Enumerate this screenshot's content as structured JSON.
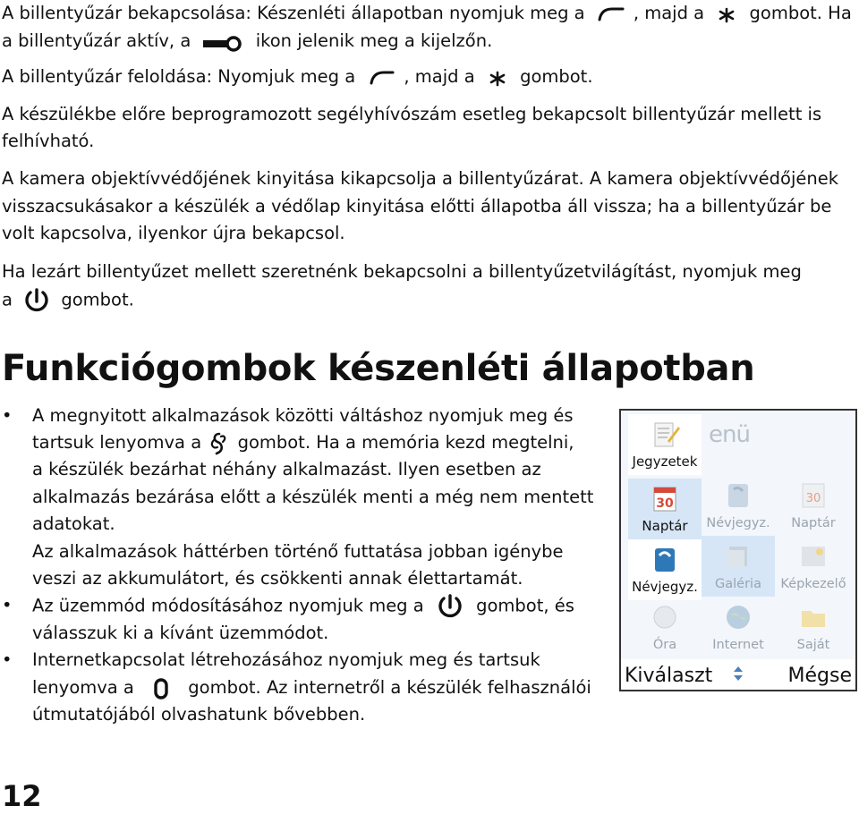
{
  "paragraphs": {
    "p1_line1_a": "A billentyűzár bekapcsolása: Készenléti állapotban nyomjuk meg a",
    "p1_line1_b": ", majd a",
    "p1_line1_c": "gombot. Ha",
    "p1_line2_a": "a billentyűzár aktív, a",
    "p1_line2_b": "ikon jelenik meg a kijelzőn.",
    "p2_a": "A billentyűzár feloldása: Nyomjuk meg a",
    "p2_b": ", majd a",
    "p2_c": "gombot.",
    "p3_line1": "A készülékbe előre beprogramozott segélyhívószám esetleg bekapcsolt billentyűzár mellett is",
    "p3_line2": "felhívható.",
    "p4_line1": "A kamera objektívvédőjének kinyitása kikapcsolja a billentyűzárat. A kamera objektívvédőjének",
    "p4_line2": "visszacsukásakor a készülék a védőlap kinyitása előtti állapotba áll vissza; ha a billentyűzár be",
    "p4_line3": "volt kapcsolva, ilyenkor újra bekapcsol.",
    "p5_line1": "Ha lezárt billentyűzet mellett szeretnénk bekapcsolni a billentyűzetvilágítást, nyomjuk meg",
    "p5_line2_a": "a",
    "p5_line2_b": "gombot."
  },
  "heading": "Funkciógombok készenléti állapotban",
  "bullets": {
    "b1_l1": "A megnyitott alkalmazások közötti váltáshoz nyomjuk meg és",
    "b1_l2_a": "tartsuk lenyomva a",
    "b1_l2_b": "gombot. Ha a memória kezd megtelni,",
    "b1_l3": "a készülék bezárhat néhány alkalmazást. Ilyen esetben az",
    "b1_l4": "alkalmazás bezárása előtt a készülék menti a még nem mentett",
    "b1_l5": "adatokat.",
    "b1_l6": "Az alkalmazások háttérben történő futtatása jobban igénybe",
    "b1_l7": "veszi az akkumulátort, és csökkenti annak élettartamát.",
    "b2_l1_a": "Az üzemmód módosításához nyomjuk meg a",
    "b2_l1_b": "gombot, és",
    "b2_l2": "válasszuk ki a kívánt üzemmódot.",
    "b3_l1": "Internetkapcsolat létrehozásához nyomjuk meg és tartsuk",
    "b3_l2_a": "lenyomva a",
    "b3_l2_b": "gombot. Az internetről a készülék felhasználói",
    "b3_l3": "útmutatójából olvashatunk bővebben."
  },
  "bullet_glyph": "•",
  "phone": {
    "title_fragment": "enü",
    "front_items": [
      "Jegyzetek",
      "Naptár",
      "Névjegyz."
    ],
    "back_items": [
      "Névjegyz.",
      "Naptár",
      "Galéria",
      "Képkezelő",
      "Óra",
      "Internet",
      "Saját"
    ],
    "softkey_left": "Kiválaszt",
    "softkey_right": "Mégse"
  },
  "page_number": "12",
  "icons": [
    "call-key-icon",
    "star-key-icon",
    "padlock-icon",
    "power-key-icon",
    "menu-key-icon",
    "zero-key-icon"
  ],
  "colors": {
    "text": "#111111",
    "phone_label_dim": "#9aa4ae"
  }
}
